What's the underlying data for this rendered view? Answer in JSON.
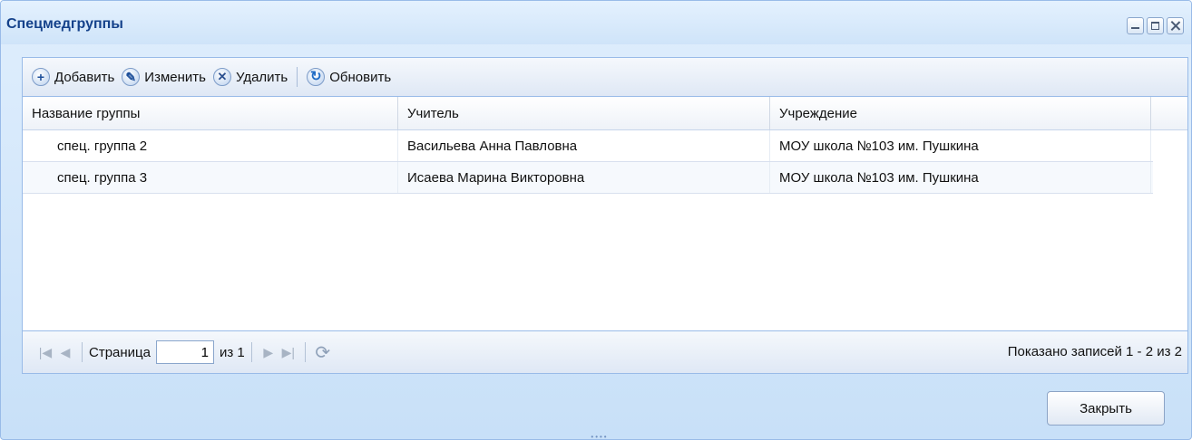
{
  "window": {
    "title": "Спецмедгруппы"
  },
  "toolbar": {
    "add_label": "Добавить",
    "edit_label": "Изменить",
    "delete_label": "Удалить",
    "refresh_label": "Обновить"
  },
  "table": {
    "columns": [
      "Название группы",
      "Учитель",
      "Учреждение"
    ],
    "rows": [
      [
        "спец. группа 2",
        "Васильева Анна Павловна",
        "МОУ школа №103 им. Пушкина"
      ],
      [
        "спец. группа 3",
        "Исаева Марина Викторовна",
        "МОУ школа №103 им. Пушкина"
      ]
    ]
  },
  "pager": {
    "page_label": "Страница",
    "page_value": "1",
    "of_label": "из 1",
    "info": "Показано записей 1 - 2 из 2"
  },
  "footer": {
    "close_label": "Закрыть"
  },
  "icons": {
    "add": "plus-circle-icon",
    "edit": "pencil-icon",
    "delete": "x-circle-icon",
    "refresh": "refresh-icon"
  }
}
